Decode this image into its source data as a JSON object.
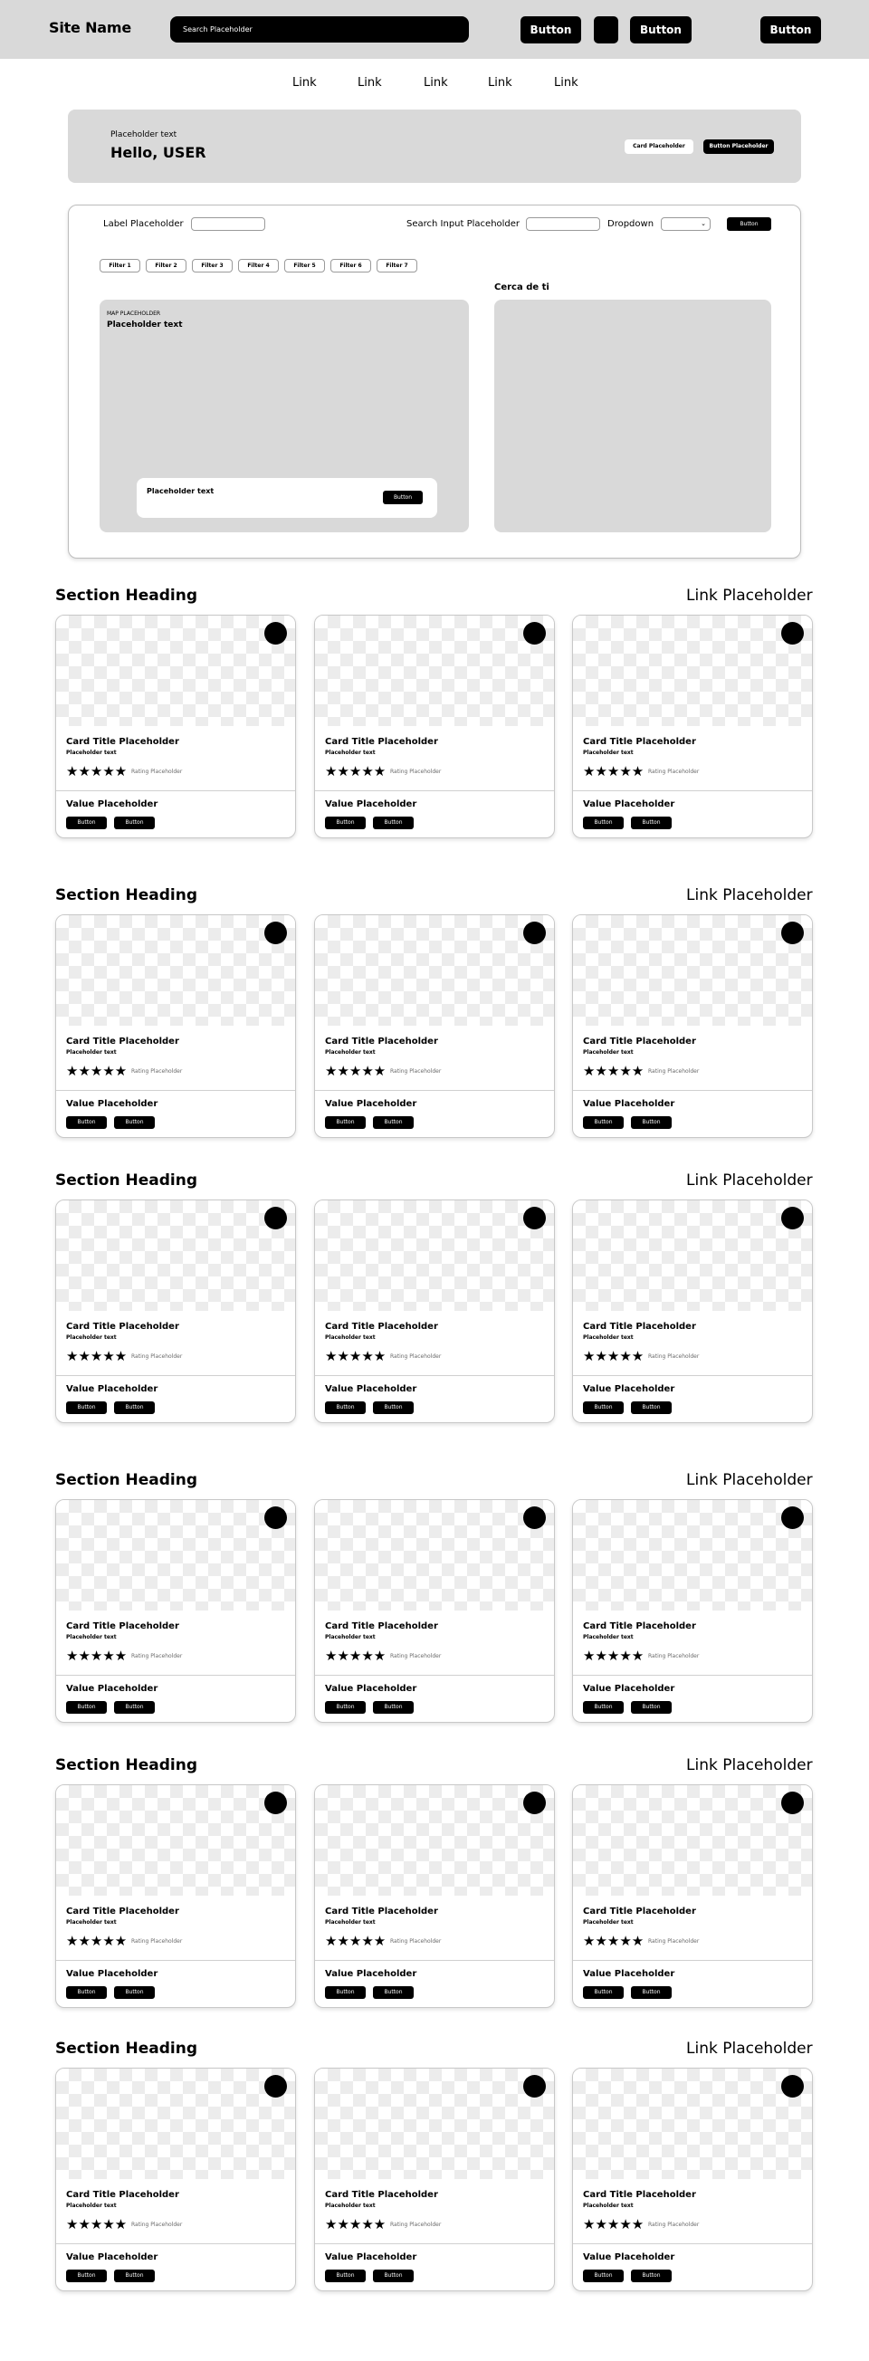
{
  "header": {
    "site_name": "Site Name",
    "search_placeholder": "Search Placeholder",
    "button_1": "Button",
    "button_2": "Button",
    "button_3": "Button"
  },
  "nav": {
    "links": [
      "Link",
      "Link",
      "Link",
      "Link",
      "Link"
    ]
  },
  "welcome": {
    "small_text": "Placeholder text",
    "greeting": "Hello, USER",
    "card_button": "Card Placeholder",
    "action_button": "Button Placeholder"
  },
  "search_panel": {
    "label": "Label Placeholder",
    "search_label": "Search Input Placeholder",
    "dropdown_label": "Dropdown",
    "button": "Button",
    "filters": [
      "Filter 1",
      "Filter 2",
      "Filter 3",
      "Filter 4",
      "Filter 5",
      "Filter 6",
      "Filter 7"
    ],
    "map": {
      "label": "MAP PLACEHOLDER",
      "title": "Placeholder text",
      "card_text": "Placeholder text",
      "card_button": "Button"
    },
    "nearby_title": "Cerca de ti"
  },
  "sections": [
    {
      "heading": "Section Heading",
      "link": "Link Placeholder"
    },
    {
      "heading": "Section Heading",
      "link": "Link Placeholder"
    },
    {
      "heading": "Section Heading",
      "link": "Link Placeholder"
    },
    {
      "heading": "Section Heading",
      "link": "Link Placeholder"
    },
    {
      "heading": "Section Heading",
      "link": "Link Placeholder"
    },
    {
      "heading": "Section Heading",
      "link": "Link Placeholder"
    }
  ],
  "card": {
    "title": "Card Title Placeholder",
    "subtitle": "Placeholder text",
    "stars": "★★★★★",
    "rating_text": "Rating Placeholder",
    "value": "Value Placeholder",
    "button_1": "Button",
    "button_2": "Button"
  }
}
